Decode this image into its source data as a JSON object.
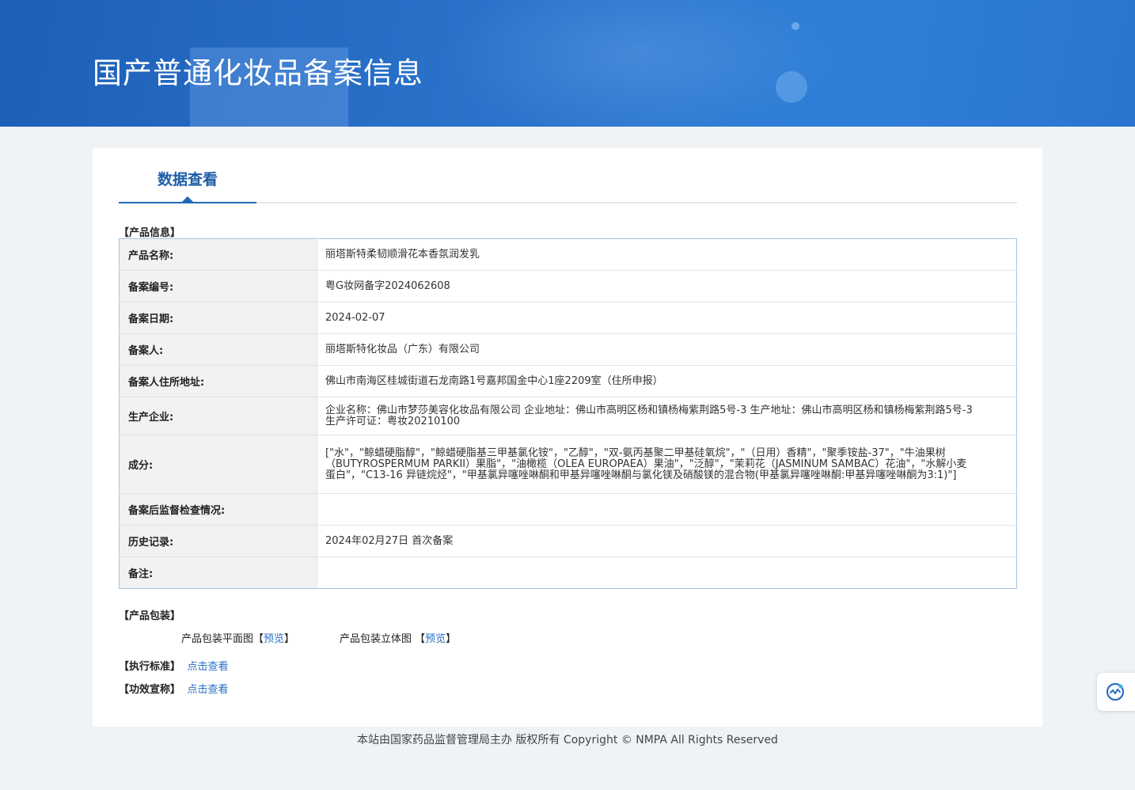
{
  "banner": {
    "title": "国产普通化妆品备案信息"
  },
  "tabs": [
    {
      "label": "数据查看",
      "active": true
    }
  ],
  "product_info": {
    "section_label": "【产品信息】",
    "rows": [
      {
        "key": "产品名称:",
        "value": "丽塔斯特柔韧顺滑花本香氛润发乳"
      },
      {
        "key": "备案编号:",
        "value": "粤G妆网备字2024062608"
      },
      {
        "key": "备案日期:",
        "value": "2024-02-07"
      },
      {
        "key": "备案人:",
        "value": "丽塔斯特化妆品（广东）有限公司"
      },
      {
        "key": "备案人住所地址:",
        "value": "佛山市南海区桂城街道石龙南路1号嘉邦国金中心1座2209室（住所申报）"
      },
      {
        "key": "生产企业:",
        "value": "企业名称：佛山市梦莎美容化妆品有限公司 企业地址：佛山市高明区杨和镇杨梅紫荆路5号-3 生产地址：佛山市高明区杨和镇杨梅紫荆路5号-3 生产许可证：粤妆20210100"
      },
      {
        "key": "成分:",
        "value": "[\"水\"，\"鲸蜡硬脂醇\"，\"鲸蜡硬脂基三甲基氯化铵\"，\"乙醇\"，\"双-氨丙基聚二甲基硅氧烷\"，\"（日用）香精\"，\"聚季铵盐-37\"，\"牛油果树（BUTYROSPERMUM PARKII）果脂\"，\"油橄榄（OLEA EUROPAEA）果油\"，\"泛醇\"，\"茉莉花（JASMINUM SAMBAC）花油\"，\"水解小麦蛋白\"，\"C13-16 异链烷烃\"，\"甲基氯异噻唑啉酮和甲基异噻唑啉酮与氯化镁及硝酸镁的混合物(甲基氯异噻唑啉酮:甲基异噻唑啉酮为3:1)\"]"
      },
      {
        "key": "备案后监督检查情况:",
        "value": ""
      },
      {
        "key": "历史记录:",
        "value": "2024年02月27日 首次备案"
      },
      {
        "key": "备注:",
        "value": ""
      }
    ]
  },
  "packaging": {
    "section_label": "【产品包装】",
    "flat_label": "产品包装平面图",
    "flat_link": "预览",
    "solid_label": "产品包装立体图",
    "solid_link": "预览"
  },
  "standard": {
    "label": "【执行标准】",
    "link": "点击查看"
  },
  "efficacy": {
    "label": "【功效宣称】",
    "link": "点击查看"
  },
  "footer": {
    "text": "本站由国家药品监督管理局主办 版权所有 Copyright © NMPA All Rights Reserved"
  },
  "float_button": {
    "icon": "ai-assistant-icon"
  }
}
